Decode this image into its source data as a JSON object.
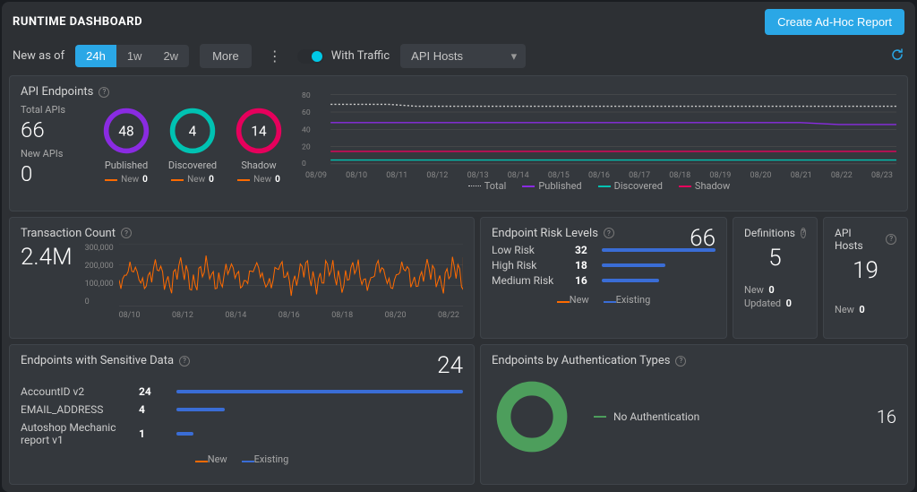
{
  "header": {
    "title": "RUNTIME DASHBOARD",
    "create_button": "Create Ad-Hoc Report"
  },
  "filters": {
    "label": "New as of",
    "ranges": [
      "24h",
      "1w",
      "2w"
    ],
    "active_index": 0,
    "more_label": "More",
    "traffic_label": "With Traffic",
    "traffic_on": true,
    "host_select": "API Hosts"
  },
  "api_endpoints": {
    "title": "API Endpoints",
    "total_label": "Total APIs",
    "total": 66,
    "new_label": "New APIs",
    "new": 0,
    "rings": [
      {
        "label": "Published",
        "value": 48,
        "new": 0,
        "color": "#8a2be2"
      },
      {
        "label": "Discovered",
        "value": 4,
        "new": 0,
        "color": "#00c2b2"
      },
      {
        "label": "Shadow",
        "value": 14,
        "new": 0,
        "color": "#e6005c"
      }
    ],
    "new_word": "New",
    "legend": [
      "Total",
      "Published",
      "Discovered",
      "Shadow"
    ]
  },
  "chart_data": {
    "type": "line",
    "title": "API Endpoints over time",
    "xlabel": "",
    "ylabel": "",
    "xticks": [
      "08/09",
      "08/10",
      "08/11",
      "08/12",
      "08/13",
      "08/14",
      "08/15",
      "08/16",
      "08/17",
      "08/18",
      "08/19",
      "08/20",
      "08/21",
      "08/22",
      "08/23"
    ],
    "yticks": [
      0,
      20,
      40,
      60,
      80
    ],
    "ylim": [
      0,
      80
    ],
    "series": [
      {
        "name": "Total",
        "color": "#cccccc",
        "style": "dotted",
        "values": [
          66,
          66,
          66,
          64,
          64,
          64,
          64,
          64,
          64,
          64,
          64,
          64,
          64,
          64,
          64
        ]
      },
      {
        "name": "Published",
        "color": "#8a2be2",
        "values": [
          48,
          48,
          48,
          48,
          48,
          48,
          48,
          48,
          48,
          48,
          48,
          48,
          46,
          46,
          46
        ]
      },
      {
        "name": "Discovered",
        "color": "#00c2b2",
        "values": [
          4,
          4,
          4,
          4,
          4,
          4,
          4,
          4,
          4,
          4,
          4,
          4,
          4,
          4,
          4
        ]
      },
      {
        "name": "Shadow",
        "color": "#e6005c",
        "values": [
          14,
          14,
          14,
          14,
          14,
          14,
          14,
          14,
          14,
          14,
          14,
          14,
          14,
          14,
          14
        ]
      }
    ]
  },
  "tx": {
    "title": "Transaction Count",
    "total": "2.4M",
    "yticks": [
      "300,000",
      "200,000",
      "100,000",
      "0"
    ],
    "xticks": [
      "08/10",
      "08/12",
      "08/14",
      "08/16",
      "08/18",
      "08/20",
      "08/22"
    ]
  },
  "risk": {
    "title": "Endpoint Risk Levels",
    "total": 66,
    "rows": [
      {
        "label": "Low Risk",
        "value": 32,
        "pct": 100
      },
      {
        "label": "High Risk",
        "value": 18,
        "pct": 56
      },
      {
        "label": "Medium Risk",
        "value": 16,
        "pct": 50
      }
    ],
    "legend_new": "New",
    "legend_existing": "Existing"
  },
  "definitions": {
    "title": "Definitions",
    "total": 5,
    "new_label": "New",
    "new": 0,
    "updated_label": "Updated",
    "updated": 0
  },
  "hosts": {
    "title": "API Hosts",
    "total": 19,
    "new_label": "New",
    "new": 0
  },
  "sensitive": {
    "title": "Endpoints with Sensitive Data",
    "total": 24,
    "rows": [
      {
        "label": "AccountID v2",
        "value": 24,
        "pct": 100
      },
      {
        "label": "EMAIL_ADDRESS",
        "value": 4,
        "pct": 17
      },
      {
        "label": "Autoshop Mechanic report v1",
        "value": 1,
        "pct": 6
      }
    ],
    "legend_new": "New",
    "legend_existing": "Existing"
  },
  "auth": {
    "title": "Endpoints by Authentication Types",
    "items": [
      {
        "label": "No Authentication",
        "value": 16,
        "color": "#4d9e5c"
      }
    ]
  },
  "colors": {
    "new": "#ff6a00",
    "existing": "#3a6dd6"
  }
}
